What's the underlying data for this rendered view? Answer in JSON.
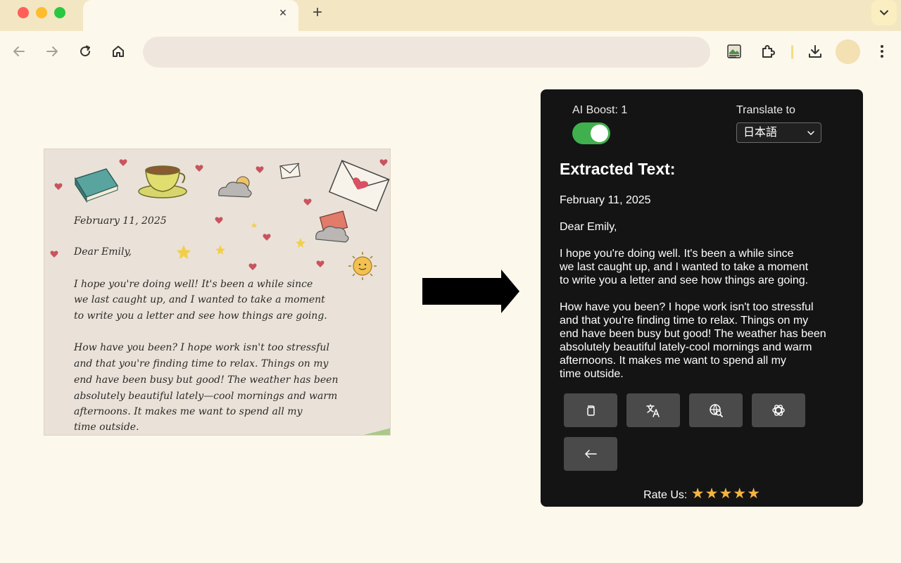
{
  "browser": {
    "tab": {
      "close_glyph": "×"
    },
    "new_tab_glyph": "+",
    "omnibox": {
      "placeholder": ""
    }
  },
  "icons": {
    "tab_menu": "chevron-down-icon",
    "back": "back-arrow-icon",
    "forward": "forward-arrow-icon",
    "reload": "reload-icon",
    "home": "home-icon",
    "extension_app": "image-to-text-extension-icon",
    "extensions": "puzzle-icon",
    "downloads": "download-icon",
    "menu": "more-vert-icon"
  },
  "letter_image": {
    "date": "February 11, 2025",
    "salutation": "Dear Emily,",
    "lines": [
      "I hope you're doing well! It's been a while since",
      "we last caught up, and I wanted to take a moment",
      "to write you a letter and see how things are going.",
      "",
      "How have you been? I hope work isn't too stressful",
      "and that you're finding time to relax. Things on my",
      "end have been busy but good! The weather has been",
      "absolutely beautiful lately—cool mornings and warm",
      "afternoons. It makes me want to spend all my",
      "time outside."
    ]
  },
  "popup": {
    "ai_boost_label": "AI Boost: 1",
    "ai_boost_enabled": true,
    "translate_label": "Translate to",
    "language": "日本語",
    "heading": "Extracted Text:",
    "paragraphs": [
      "February 11, 2025",
      "Dear Emily,",
      "I hope you're doing well. It's been a while since\nwe last caught up, and I wanted to take a moment\nto write you a letter and see how things are going.",
      "How have you been? I hope work isn't too stressful\nand that you're finding time to relax. Things on my\nend have been busy but good! The weather has been\nabsolutely beautiful lately-cool mornings and warm\nafternoons. It makes me want to spend all my\ntime outside."
    ],
    "actions": [
      "copy-icon",
      "translate-icon",
      "web-search-icon",
      "chatgpt-icon",
      "back-arrow-icon"
    ],
    "rate_label": "Rate Us:",
    "stars": [
      "★",
      "★",
      "★",
      "★",
      "★"
    ],
    "colors": {
      "toggle_on": "#3fb04d",
      "star": "#f5b43b",
      "panel": "#141414"
    }
  }
}
